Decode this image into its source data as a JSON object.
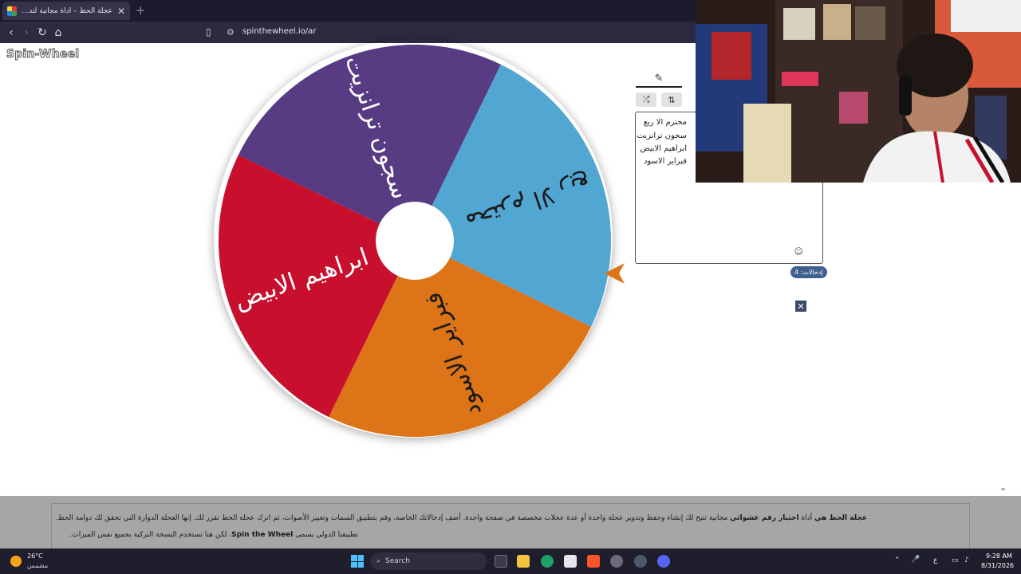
{
  "browser": {
    "tab_title": "عجلة الحظ – أداة مجانية لتدوير الع...",
    "tab_close": "✕",
    "new_tab": "+",
    "url": "spinthewheel.io/ar"
  },
  "page": {
    "logo": "Spin-Wheel",
    "wheel": {
      "segments": [
        {
          "label": "محترم الا ربع",
          "color": "#52a6d2",
          "text_color": "#1a1a1a"
        },
        {
          "label": "فبراير الاسود",
          "color": "#dd7518",
          "text_color": "#1a1a1a"
        },
        {
          "label": "ابراهيم الابيض",
          "color": "#c8102e",
          "text_color": "#ffffff"
        },
        {
          "label": "سجون ترانزيت",
          "color": "#573b83",
          "text_color": "#ffffff"
        }
      ],
      "pointer_color": "#dd7518"
    },
    "editor": {
      "edit_tab_icon": "✎",
      "shuffle_icon": "⤮",
      "sort_icon": "⇅",
      "entries": [
        "محترم الا ربع",
        "سجون ترانزيت",
        "ابراهيم الابيض",
        "فبراير الاسود"
      ],
      "emoji_icon": "☺",
      "count_label": "إدخالات: 4"
    },
    "close_icon": "✕",
    "chevron_icon": "⌄"
  },
  "footer": {
    "line1_bold_a": "عجلة الحظ هي",
    "line1_a": " أداة ",
    "line1_bold_b": "اختيار رقم عشوائي",
    "line1_b": " مجانية تتيح لك إنشاء وحفظ وتدوير عجلة واحدة أو عدة عجلات مخصصة في صفحة واحدة. أضف إدخالاتك الخاصة، وقم بتطبيق السمات وتغيير الأصوات، ثم اترك عجلة الحظ تقرر لك. إنها العجلة الدوارة التي تحقق لك دوامة الحظ.",
    "line2_a": "تطبيقنا الدولي يسمى ",
    "line2_bold": "Spin the Wheel",
    "line2_b": ". لكن هنا تستخدم النسخة التركية بجميع نفس الميزات."
  },
  "taskbar": {
    "temperature": "26°C",
    "condition": "مشمس",
    "search_placeholder": "Search",
    "lang": "ع",
    "time": "9:28 AM",
    "date": "8/31/2026"
  }
}
